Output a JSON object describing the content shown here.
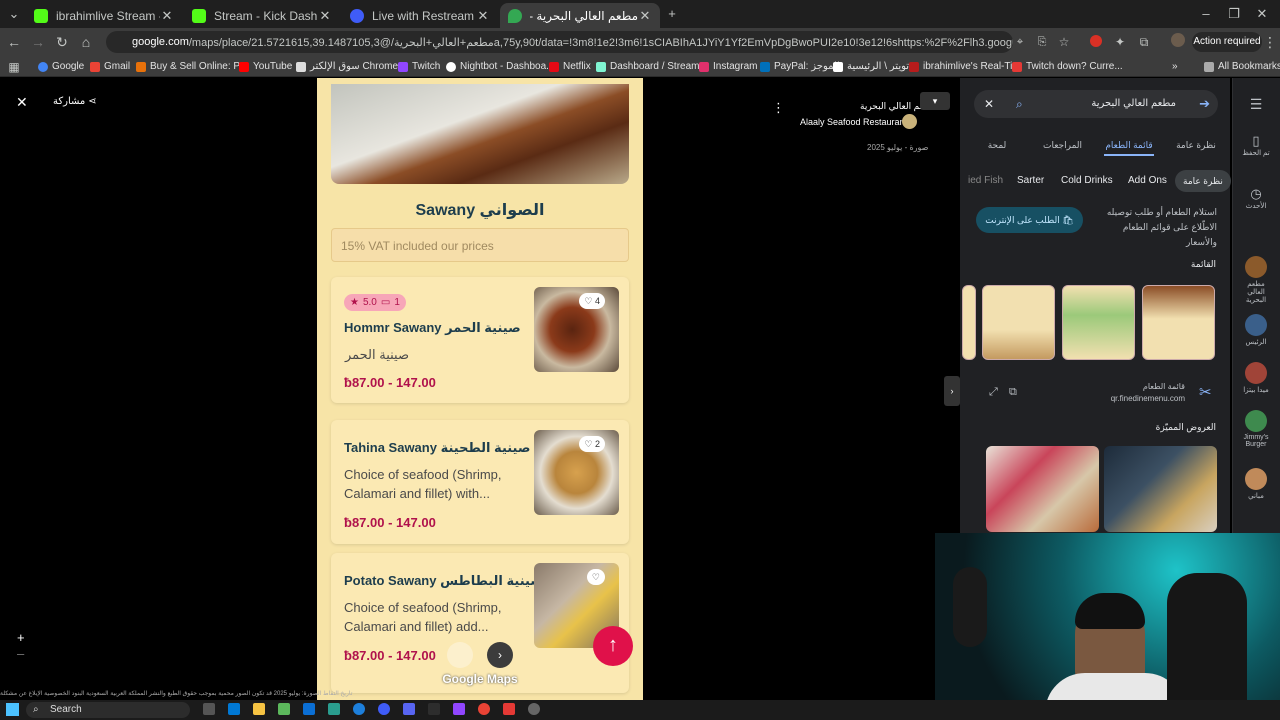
{
  "browser": {
    "tabs": [
      {
        "title": "ibrahimlive Stream - Watch Live",
        "color": "#53fc18"
      },
      {
        "title": "Stream - Kick Dashboard",
        "color": "#53fc18"
      },
      {
        "title": "Live with Restream - Restream",
        "color": "#3f5cf7"
      },
      {
        "title": "مطعم العالي البحرية - خرائط Google",
        "color": "#34a853"
      }
    ],
    "url_host": "google.com",
    "url_rest": "/maps/place/مطعم+العالي+البحرية/@21.5721615,39.1487105,3a,75y,90t/data=!3m8!1e2!3m6!1sCIABIhA1JYiY1Yf2EmVpDgBwoPUI2e10!3e12!6shttps:%2F%2Flh3.googleusercontent.com...",
    "action_required": "Action required",
    "bookmarks": [
      "Google",
      "Gmail",
      "Buy & Sell Online: P...",
      "YouTube",
      "سوق الإلكتر Chrome",
      "Twitch",
      "Nightbot - Dashboa...",
      "Netflix",
      "Dashboard / Stream...",
      "Instagram",
      "PayPal: الموجز",
      "تويتر \\ الرئيسية",
      "ibrahimlive's Real-Ti...",
      "Twitch down? Curre..."
    ],
    "all_bookmarks": "All Bookmarks"
  },
  "viewer": {
    "share": "مشاركة",
    "place_ar": "مطعم العالي البحرية",
    "place_en": "Alaaly Seafood Restaurant",
    "photo_date": "صورة - يوليو 2025"
  },
  "menu": {
    "section_title": "Sawany الصواني",
    "vat": "15% VAT included our prices",
    "rating": "5.0",
    "reviews": "1",
    "items": [
      {
        "name": "Hommr Sawany صينية الحمر",
        "desc": "صينية الحمر",
        "price": "87.00 - 147.00",
        "likes": "4"
      },
      {
        "name": "Tahina Sawany صينية الطحينة",
        "desc": "Choice of seafood (Shrimp, Calamari and fillet) with...",
        "price": "87.00 - 147.00",
        "likes": "2"
      },
      {
        "name": "Potato Sawany صينية البطاطس",
        "desc": "Choice of seafood (Shrimp, Calamari and fillet) add...",
        "price": "87.00 - 147.00",
        "likes": ""
      }
    ],
    "currency": "ƀ",
    "watermark": "Google Maps"
  },
  "side": {
    "search": "مطعم العالي البحرية",
    "tabs": [
      "لمحة",
      "المراجعات",
      "قائمة الطعام",
      "نظرة عامة"
    ],
    "chips": [
      "ied Fish",
      "Sarter",
      "Cold Drinks",
      "Add Ons",
      "نظرة عامة"
    ],
    "order_button": "الطلب على الإنترنت",
    "order_desc": "استلام الطعام أو طلب توصيله الاطّلاع على قوائم الطعام والأسعار",
    "menu_label": "القائمة",
    "menu_source_title": "قائمة الطعام",
    "menu_source_domain": "qr.finedinemenu.com",
    "featured_label": "العروض المميّزة"
  },
  "rail": [
    {
      "label": "تم الحفظ"
    },
    {
      "label": "الأحدث"
    },
    {
      "label": "مطعم العالي البحرية"
    },
    {
      "label": "الرئيس"
    },
    {
      "label": "ميدا بيتزا"
    },
    {
      "label": "Jimmy's Burger"
    },
    {
      "label": "مباني"
    }
  ],
  "status_bar": "تاريخ التقاط الصورة: يوليو 2025   قد تكون الصور محمية بموجب حقوق الطبع والنشر   المملكة العربية السعودية   البنود   الخصوصية   الإبلاغ عن مشكلة",
  "taskbar": {
    "search": "Search"
  }
}
